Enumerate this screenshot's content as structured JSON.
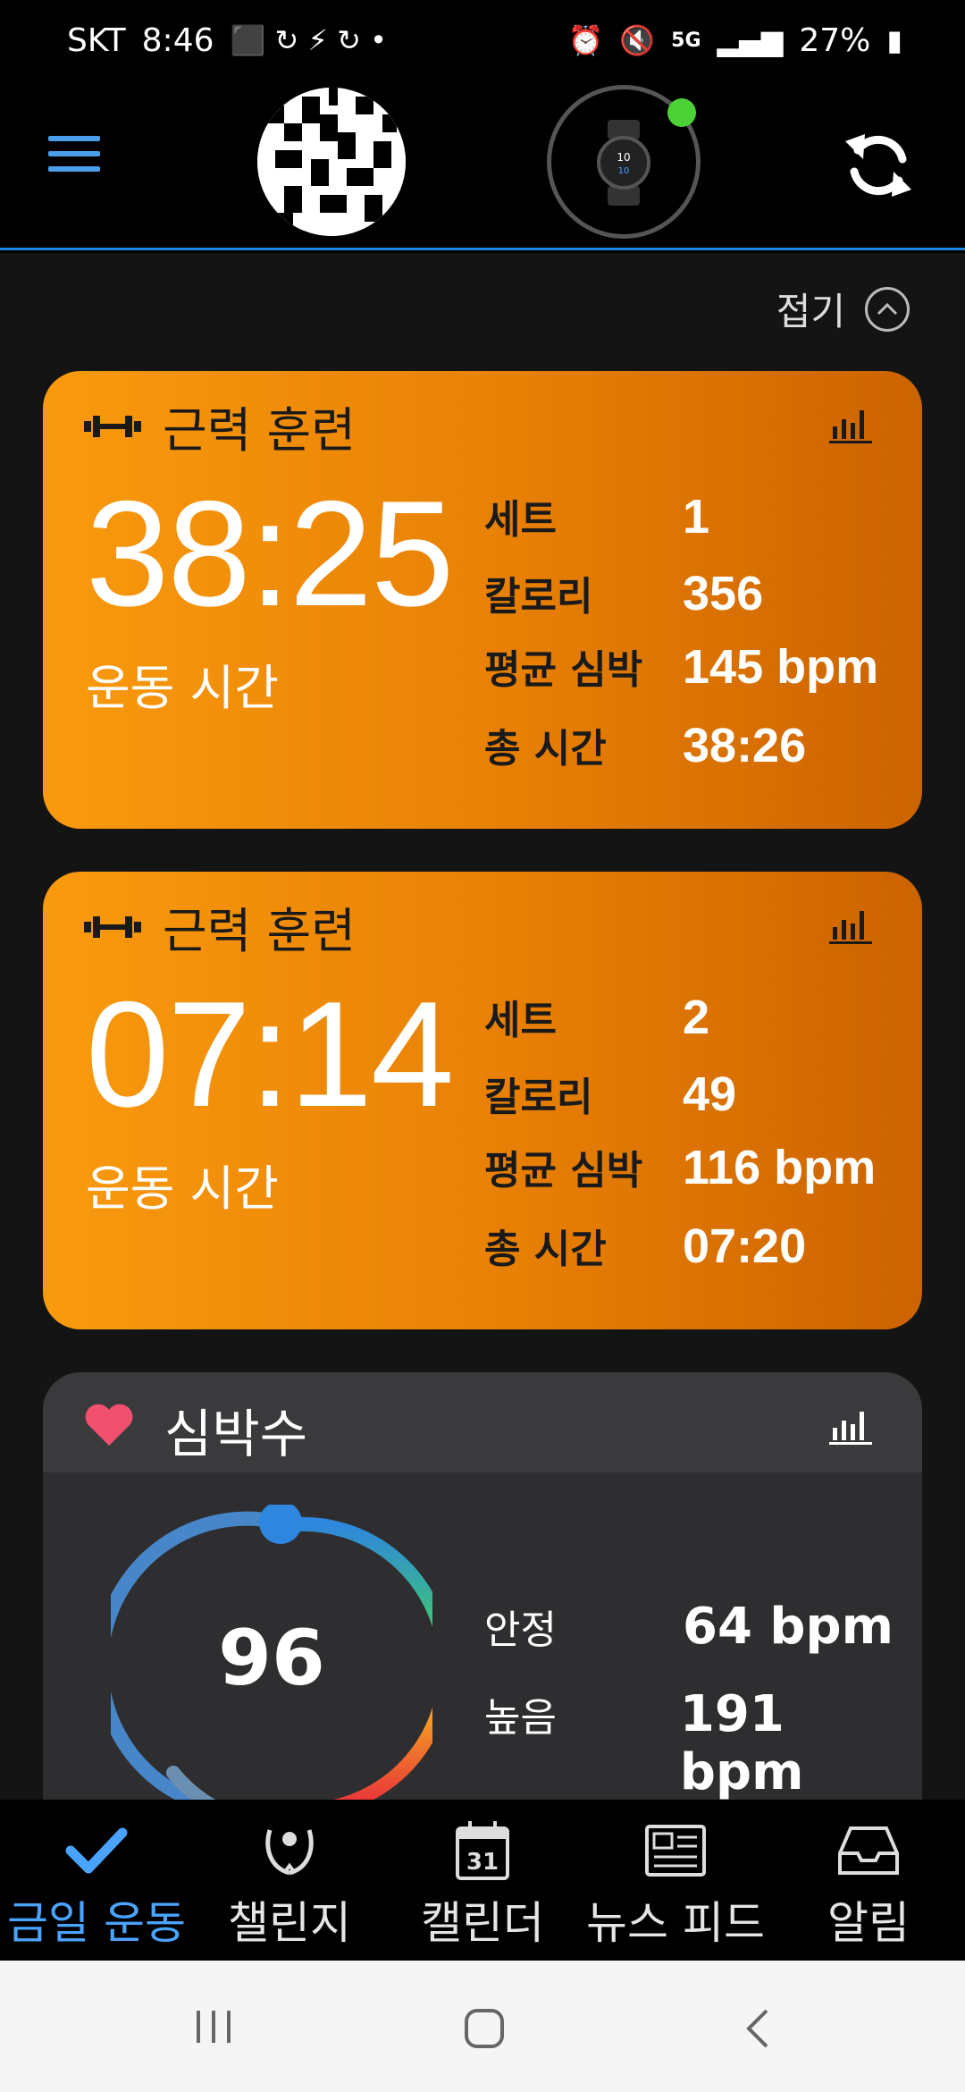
{
  "status_bar": {
    "carrier": "SKT",
    "time": "8:46",
    "battery": "27%",
    "network": "5G"
  },
  "header": {
    "menu_icon": "hamburger-icon",
    "avatar": "profile-avatar",
    "device_status_color": "#4cd137",
    "sync_icon": "sync-icon"
  },
  "collapse_label": "접기",
  "activities": [
    {
      "title": "근력 훈련",
      "duration": "38:25",
      "duration_label": "운동 시간",
      "stats": [
        {
          "label": "세트",
          "value": "1"
        },
        {
          "label": "칼로리",
          "value": "356"
        },
        {
          "label": "평균 심박",
          "value": "145 bpm"
        },
        {
          "label": "총 시간",
          "value": "38:26"
        }
      ]
    },
    {
      "title": "근력 훈련",
      "duration": "07:14",
      "duration_label": "운동 시간",
      "stats": [
        {
          "label": "세트",
          "value": "2"
        },
        {
          "label": "칼로리",
          "value": "49"
        },
        {
          "label": "평균 심박",
          "value": "116 bpm"
        },
        {
          "label": "총 시간",
          "value": "07:20"
        }
      ]
    }
  ],
  "heart_rate": {
    "title": "심박수",
    "current": "96",
    "resting_label": "안정",
    "resting_value": "64 bpm",
    "high_label": "높음",
    "high_value": "191 bpm"
  },
  "bottom_nav": [
    {
      "label": "금일 운동",
      "icon": "check-icon",
      "active": true
    },
    {
      "label": "챌린지",
      "icon": "laurel-icon",
      "active": false
    },
    {
      "label": "캘린더",
      "icon": "calendar-icon",
      "calendar_day": "31",
      "active": false
    },
    {
      "label": "뉴스 피드",
      "icon": "newspaper-icon",
      "active": false
    },
    {
      "label": "알림",
      "icon": "inbox-icon",
      "active": false
    }
  ],
  "accent_color": "#4aa3ff"
}
